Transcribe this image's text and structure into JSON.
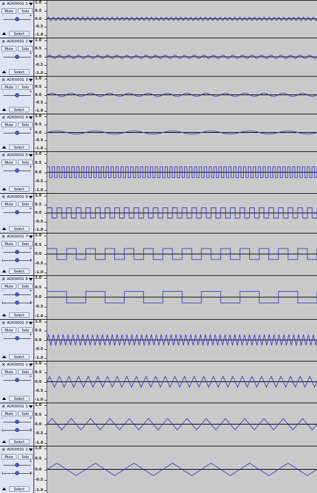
{
  "colors": {
    "waveform": "#3232c8",
    "background": "#c9c9c9",
    "track_panel": "#dfe4f4",
    "center_line": "#000000"
  },
  "ruler_ticks": [
    "1.0",
    "0.5",
    "0.0",
    "-0.5",
    "-1.0"
  ],
  "controls": {
    "mute_label": "Mute",
    "solo_label": "Solo",
    "select_label": "Select",
    "gain_minus": "-",
    "gain_plus": "+",
    "pan_left": "L",
    "pan_right": "R"
  },
  "tracks": [
    {
      "name": "AD00001 1",
      "wave": "sine",
      "cycles": 55,
      "amplitude": 0.1,
      "has_pan": false
    },
    {
      "name": "AD00001 2",
      "wave": "sine",
      "cycles": 28,
      "amplitude": 0.1,
      "has_pan": false
    },
    {
      "name": "AD00001 3",
      "wave": "sine",
      "cycles": 14,
      "amplitude": 0.1,
      "has_pan": false
    },
    {
      "name": "AD00001 4",
      "wave": "sine",
      "cycles": 7,
      "amplitude": 0.1,
      "has_pan": false
    },
    {
      "name": "AD00001 5",
      "wave": "square",
      "cycles": 55,
      "amplitude": 0.3,
      "has_pan": false
    },
    {
      "name": "AD00001 6",
      "wave": "square",
      "cycles": 28,
      "amplitude": 0.3,
      "has_pan": false
    },
    {
      "name": "AD00001 7",
      "wave": "square",
      "cycles": 14,
      "amplitude": 0.3,
      "has_pan": true
    },
    {
      "name": "AD00001 8",
      "wave": "square",
      "cycles": 7,
      "amplitude": 0.3,
      "has_pan": true
    },
    {
      "name": "AD00001 9",
      "wave": "triangle",
      "cycles": 55,
      "amplitude": 0.3,
      "has_pan": false
    },
    {
      "name": "AD00001 10",
      "wave": "triangle",
      "cycles": 28,
      "amplitude": 0.3,
      "has_pan": false
    },
    {
      "name": "AD00001 11",
      "wave": "triangle",
      "cycles": 14,
      "amplitude": 0.3,
      "has_pan": true
    },
    {
      "name": "AD00001 12",
      "wave": "triangle",
      "cycles": 7,
      "amplitude": 0.3,
      "has_pan": true
    }
  ]
}
